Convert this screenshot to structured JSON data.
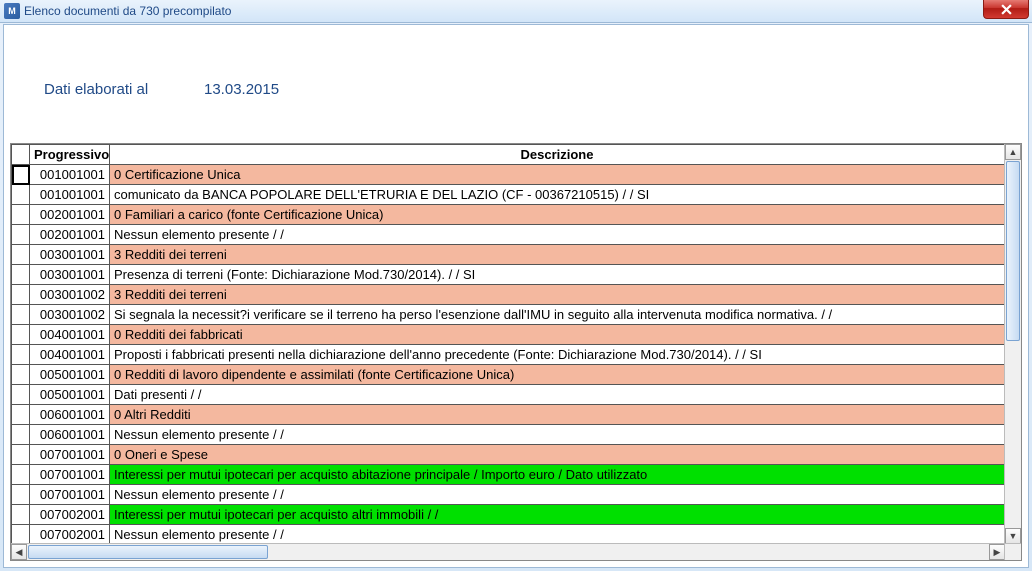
{
  "window": {
    "title": "Elenco documenti da 730 precompilato"
  },
  "header": {
    "label": "Dati elaborati al",
    "date": "13.03.2015"
  },
  "columns": {
    "progressivo": "Progressivo",
    "descrizione": "Descrizione"
  },
  "rows": [
    {
      "prog": "001001001",
      "desc": "0 Certificazione Unica",
      "style": "salmon",
      "current": true
    },
    {
      "prog": "001001001",
      "desc": "comunicato da BANCA POPOLARE DELL'ETRURIA E DEL LAZIO (CF - 00367210515) /          / SI",
      "style": "white"
    },
    {
      "prog": "002001001",
      "desc": "0 Familiari a carico (fonte Certificazione Unica)",
      "style": "salmon"
    },
    {
      "prog": "002001001",
      "desc": "Nessun elemento presente /          /",
      "style": "white"
    },
    {
      "prog": "003001001",
      "desc": "3 Redditi dei terreni",
      "style": "salmon"
    },
    {
      "prog": "003001001",
      "desc": "Presenza di terreni (Fonte: Dichiarazione Mod.730/2014). /          / SI",
      "style": "white"
    },
    {
      "prog": "003001002",
      "desc": "3 Redditi dei terreni",
      "style": "salmon"
    },
    {
      "prog": "003001002",
      "desc": "Si segnala la necessit?i verificare se il terreno ha perso l'esenzione dall'IMU in seguito alla intervenuta modifica normativa. /          /",
      "style": "white"
    },
    {
      "prog": "004001001",
      "desc": "0 Redditi dei fabbricati",
      "style": "salmon"
    },
    {
      "prog": "004001001",
      "desc": "Proposti i fabbricati presenti nella dichiarazione dell'anno precedente (Fonte: Dichiarazione Mod.730/2014). /          / SI",
      "style": "white"
    },
    {
      "prog": "005001001",
      "desc": "0 Redditi di lavoro dipendente e assimilati (fonte Certificazione Unica)",
      "style": "salmon"
    },
    {
      "prog": "005001001",
      "desc": "Dati presenti /          /",
      "style": "white"
    },
    {
      "prog": "006001001",
      "desc": "0 Altri Redditi",
      "style": "salmon"
    },
    {
      "prog": "006001001",
      "desc": "Nessun elemento presente /          /",
      "style": "white"
    },
    {
      "prog": "007001001",
      "desc": "0 Oneri e Spese",
      "style": "salmon"
    },
    {
      "prog": "007001001",
      "desc": "Interessi per mutui ipotecari per acquisto abitazione principale / Importo euro / Dato utilizzato",
      "style": "green"
    },
    {
      "prog": "007001001",
      "desc": "Nessun elemento presente /          /",
      "style": "white"
    },
    {
      "prog": "007002001",
      "desc": "Interessi per mutui ipotecari per acquisto altri immobili /  /",
      "style": "green"
    },
    {
      "prog": "007002001",
      "desc": "Nessun elemento presente /          /",
      "style": "white"
    }
  ]
}
